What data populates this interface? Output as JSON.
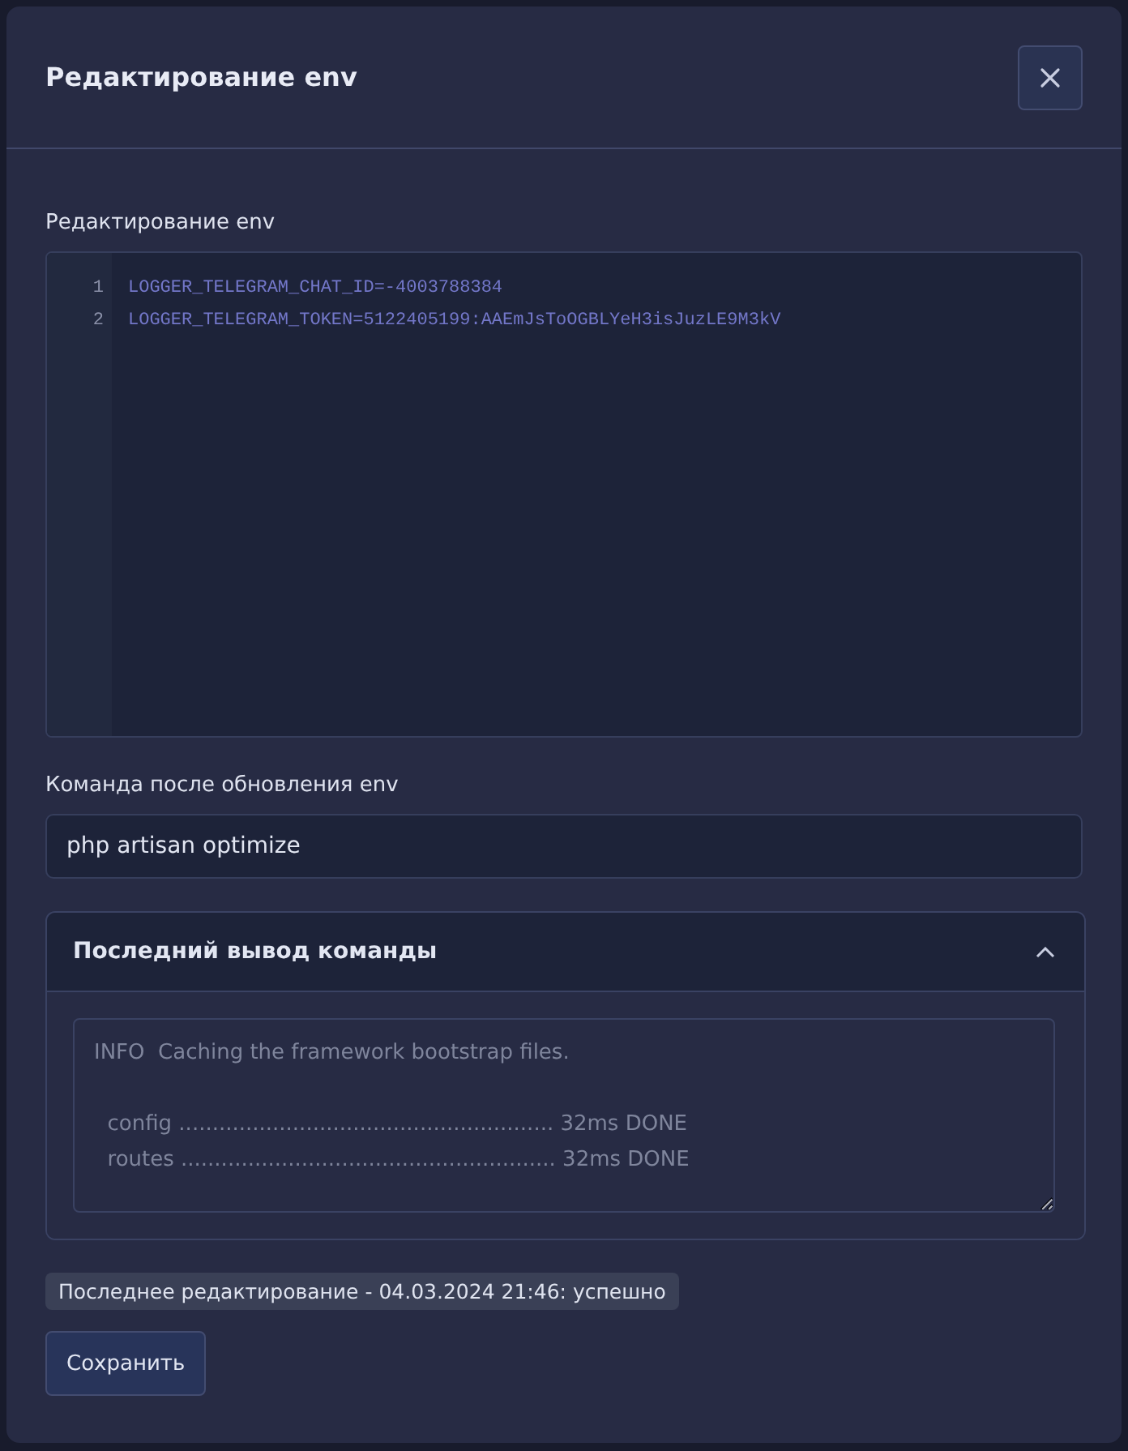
{
  "dialog": {
    "title": "Редактирование env"
  },
  "editor": {
    "label": "Редактирование env",
    "lines": [
      {
        "number": "1",
        "text": "LOGGER_TELEGRAM_CHAT_ID=-4003788384"
      },
      {
        "number": "2",
        "text": "LOGGER_TELEGRAM_TOKEN=5122405199:AAEmJsToOGBLYeH3isJuzLE9M3kV"
      }
    ]
  },
  "command": {
    "label": "Команда после обновления env",
    "value": "php artisan optimize"
  },
  "output_panel": {
    "title": "Последний вывод команды",
    "expanded": true,
    "output": "INFO  Caching the framework bootstrap files.\n\n  config ........................................................ 32ms DONE\n  routes ........................................................ 32ms DONE"
  },
  "status": "Последнее редактирование - 04.03.2024 21:46: успешно",
  "buttons": [
    {
      "label": "Сохранить"
    }
  ]
}
